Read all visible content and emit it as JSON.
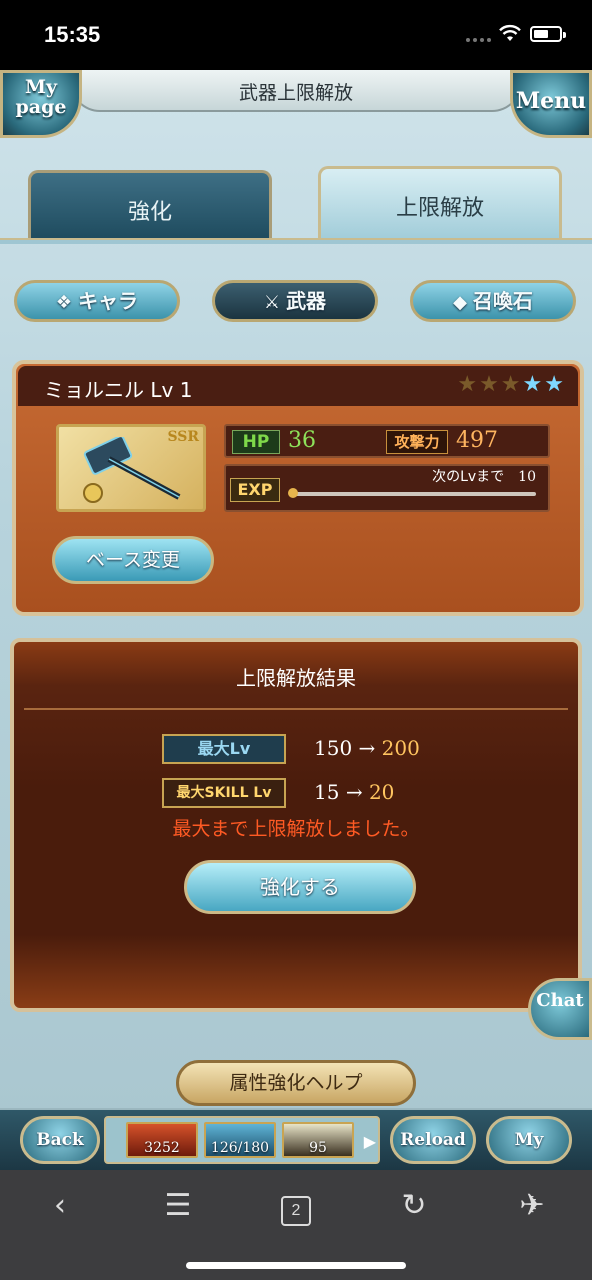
{
  "status_bar": {
    "time": "15:35"
  },
  "header": {
    "title": "武器上限解放",
    "left_button": "My page",
    "right_button": "Menu"
  },
  "tabs": [
    {
      "label": "強化",
      "active": false
    },
    {
      "label": "上限解放",
      "active": true
    }
  ],
  "categories": [
    {
      "label": "キャラ",
      "icon": "chara-icon",
      "active": false
    },
    {
      "label": "武器",
      "icon": "swords-icon",
      "active": true
    },
    {
      "label": "召喚石",
      "icon": "crystal-icon",
      "active": false
    }
  ],
  "weapon": {
    "name": "ミョルニル Lv 1",
    "rarity": "SSR",
    "stars_filled": 3,
    "stars_total": 5,
    "hp_label": "HP",
    "hp": "36",
    "atk_label": "攻撃力",
    "atk": "497",
    "exp_label": "EXP",
    "next_lv_label": "次のLvまで",
    "next_lv_value": "10",
    "exp_progress": 0,
    "base_change_label": "ベース変更"
  },
  "result": {
    "title": "上限解放結果",
    "max_lv_label": "最大Lv",
    "max_lv_from": "150",
    "max_lv_to": "200",
    "max_skill_label": "最大SKILL Lv",
    "max_skill_from": "15",
    "max_skill_to": "20",
    "arrow": "→",
    "message": "最大まで上限解放しました。",
    "enhance_button": "強化する"
  },
  "chat_label": "Chat",
  "help_button": "属性強化ヘルプ",
  "game_bar": {
    "back": "Back",
    "reload": "Reload",
    "mypage": "My page",
    "items": [
      "3252",
      "126/180",
      "95"
    ]
  },
  "browser_bar": {
    "tab_count": "2"
  },
  "colors": {
    "panel_orange": "#b85a26",
    "panel_dark": "#4a1c0c",
    "message_red": "#ff5a24",
    "value_gold": "#ffc560",
    "hp_green": "#8ee25a"
  }
}
